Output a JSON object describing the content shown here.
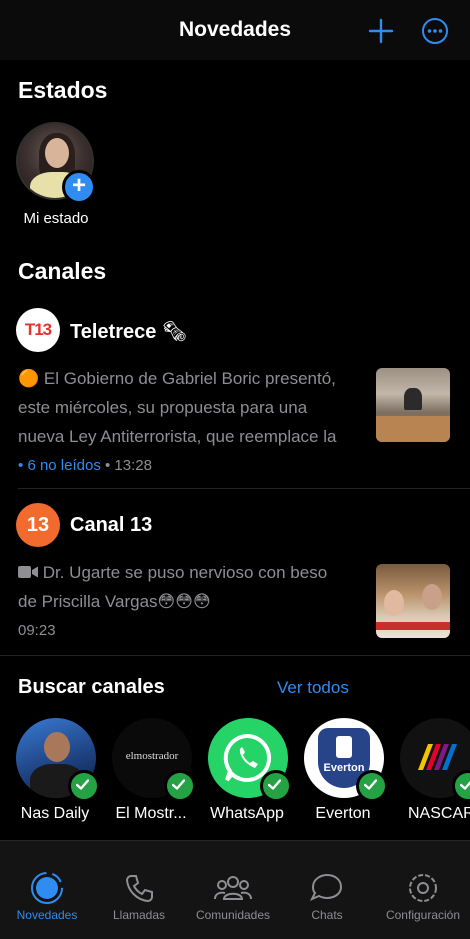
{
  "header": {
    "title": "Novedades"
  },
  "statuses": {
    "title": "Estados",
    "my_status_label": "Mi estado"
  },
  "channels": {
    "title": "Canales",
    "items": [
      {
        "logo": "T13",
        "name": "Teletrece",
        "emoji": "🗞",
        "prefix": "🟠",
        "lines": [
          "El Gobierno de Gabriel Boric presentó,",
          "este miércoles, su propuesta para una",
          "nueva Ley Antiterrorista, que reemplace la"
        ],
        "unread": "6 no leídos",
        "time": "13:28"
      },
      {
        "logo": "13",
        "name": "Canal 13",
        "lines": [
          "Dr. Ugarte se puso nervioso con beso",
          "de Priscilla Vargas😳😳😳"
        ],
        "time": "09:23"
      }
    ]
  },
  "find": {
    "title": "Buscar canales",
    "see_all": "Ver todos",
    "items": [
      {
        "label": "Nas Daily"
      },
      {
        "label": "El Mostr...",
        "logo_text": "elmostrador"
      },
      {
        "label": "WhatsApp"
      },
      {
        "label": "Everton",
        "logo_text": "Everton"
      },
      {
        "label": "NASCAR"
      }
    ]
  },
  "tabs": [
    {
      "label": "Novedades",
      "icon": "updates-icon",
      "active": true
    },
    {
      "label": "Llamadas",
      "icon": "phone-icon"
    },
    {
      "label": "Comunidades",
      "icon": "communities-icon"
    },
    {
      "label": "Chats",
      "icon": "chats-icon"
    },
    {
      "label": "Configuración",
      "icon": "settings-icon"
    }
  ],
  "colors": {
    "accent": "#2f8cf0",
    "verified": "#25a244",
    "canal13": "#f26a2e",
    "whatsapp": "#25d366"
  }
}
